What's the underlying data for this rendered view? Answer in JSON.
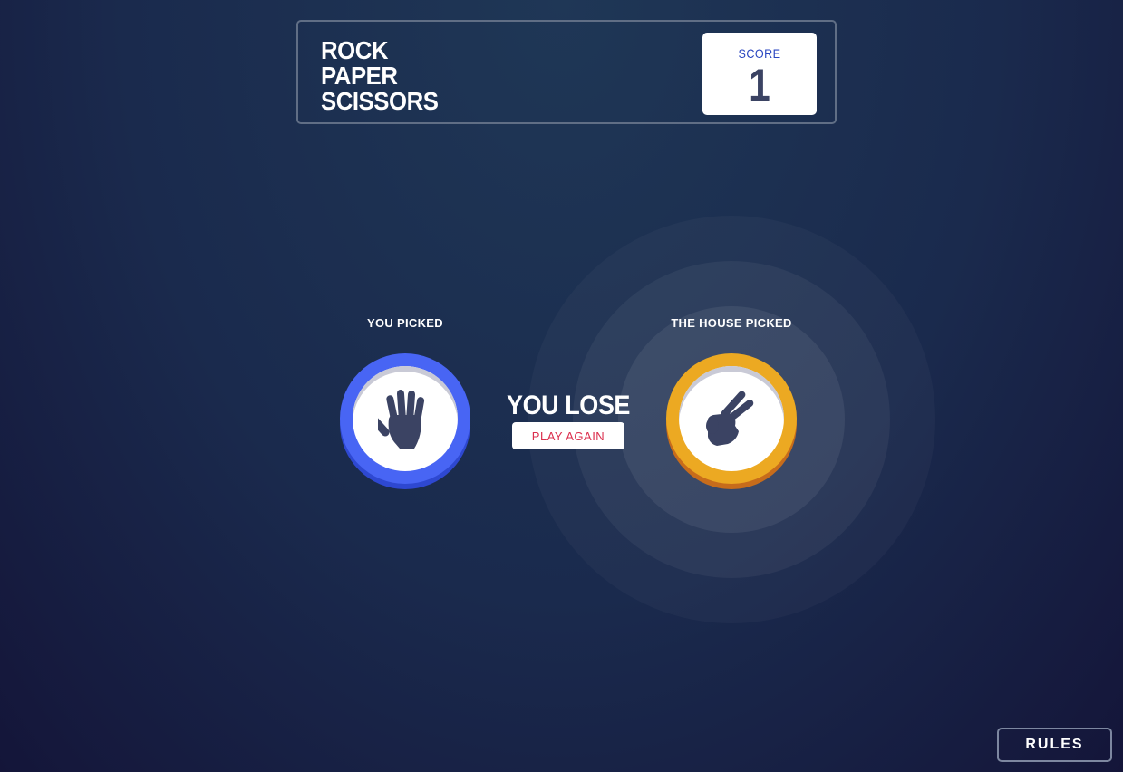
{
  "header": {
    "title_lines": [
      "ROCK",
      "PAPER",
      "SCISSORS"
    ],
    "score_label": "SCORE",
    "score_value": "1"
  },
  "player": {
    "label": "YOU PICKED",
    "choice": "paper",
    "icon": "paper-hand-icon",
    "ring_color": "#4865f4"
  },
  "house": {
    "label": "THE HOUSE PICKED",
    "choice": "scissors",
    "icon": "scissors-hand-icon",
    "ring_color": "#eca922",
    "winner": true
  },
  "result": {
    "text": "YOU LOSE",
    "play_again_label": "PLAY AGAIN",
    "play_again_color": "#db2e4d"
  },
  "footer": {
    "rules_label": "RULES"
  }
}
